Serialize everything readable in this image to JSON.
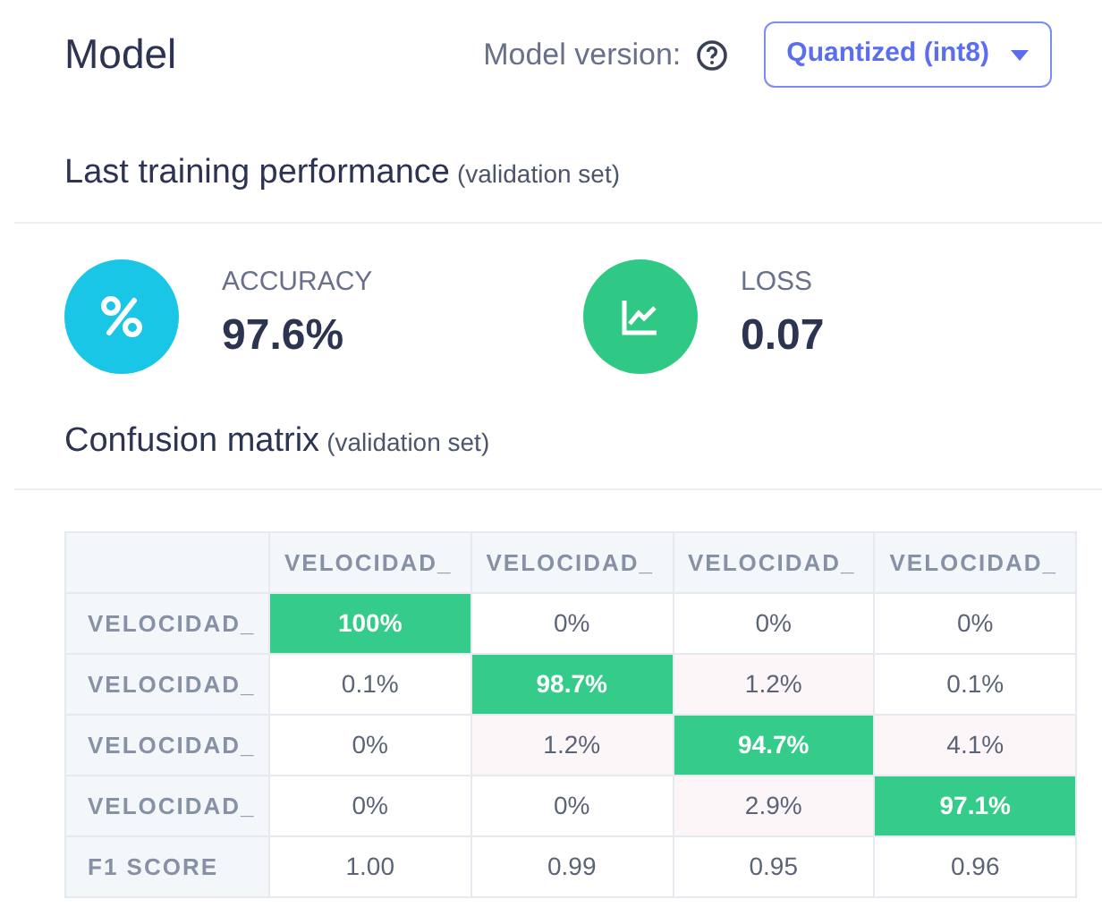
{
  "header": {
    "title": "Model",
    "version_label": "Model version:",
    "version_select": "Quantized (int8)"
  },
  "performance": {
    "title": "Last training performance",
    "note": "(validation set)",
    "metrics": [
      {
        "kind": "percent",
        "label": "ACCURACY",
        "value": "97.6%"
      },
      {
        "kind": "chart",
        "label": "LOSS",
        "value": "0.07"
      }
    ]
  },
  "confusion": {
    "title": "Confusion matrix",
    "note": "(validation set)",
    "columns": [
      "VELOCIDAD_",
      "VELOCIDAD_",
      "VELOCIDAD_",
      "VELOCIDAD_"
    ],
    "rows": [
      {
        "label": "VELOCIDAD_",
        "cells": [
          {
            "text": "100%",
            "kind": "correct"
          },
          {
            "text": "0%",
            "kind": "plain"
          },
          {
            "text": "0%",
            "kind": "plain"
          },
          {
            "text": "0%",
            "kind": "plain"
          }
        ]
      },
      {
        "label": "VELOCIDAD_",
        "cells": [
          {
            "text": "0.1%",
            "kind": "plain"
          },
          {
            "text": "98.7%",
            "kind": "correct"
          },
          {
            "text": "1.2%",
            "kind": "error"
          },
          {
            "text": "0.1%",
            "kind": "plain"
          }
        ]
      },
      {
        "label": "VELOCIDAD_",
        "cells": [
          {
            "text": "0%",
            "kind": "plain"
          },
          {
            "text": "1.2%",
            "kind": "error"
          },
          {
            "text": "94.7%",
            "kind": "correct"
          },
          {
            "text": "4.1%",
            "kind": "error"
          }
        ]
      },
      {
        "label": "VELOCIDAD_",
        "cells": [
          {
            "text": "0%",
            "kind": "plain"
          },
          {
            "text": "0%",
            "kind": "plain"
          },
          {
            "text": "2.9%",
            "kind": "error"
          },
          {
            "text": "97.1%",
            "kind": "correct"
          }
        ]
      },
      {
        "label": "F1 SCORE",
        "cells": [
          {
            "text": "1.00",
            "kind": "plain"
          },
          {
            "text": "0.99",
            "kind": "plain"
          },
          {
            "text": "0.95",
            "kind": "plain"
          },
          {
            "text": "0.96",
            "kind": "plain"
          }
        ]
      }
    ]
  }
}
